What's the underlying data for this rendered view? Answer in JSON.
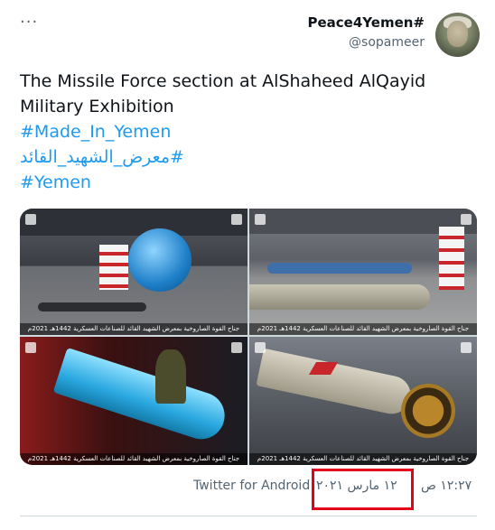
{
  "header": {
    "more_icon": "more-horizontal-icon",
    "display_name": "Peace4Yemen#",
    "handle": "@sopameer"
  },
  "tweet": {
    "line1": "The Missile Force section at AlShaheed AlQayid",
    "line2": "Military Exhibition",
    "hashtags": [
      "#Made_In_Yemen",
      "#معرض_الشهيد_القائد",
      "#Yemen"
    ]
  },
  "media": {
    "captions": [
      "جناح القوة الصاروخية بمعرض الشهيد القائد للصناعات العسكرية 1442هـ 2021م",
      "جناح القوة الصاروخية بمعرض الشهيد القائد للصناعات العسكرية 1442هـ 2021م",
      "جناح القوة الصاروخية بمعرض الشهيد القائد للصناعات العسكرية 1442هـ 2021م",
      "جناح القوة الصاروخية بمعرض الشهيد القائد للصناعات العسكرية 1442هـ 2021م"
    ]
  },
  "meta": {
    "time": "١٢:٢٧ ص",
    "separator": "·",
    "date": "١٢ مارس ٢٠٢١",
    "source": "Twitter for Android"
  },
  "colors": {
    "link": "#1d9bf0",
    "secondary_text": "#536471",
    "highlight_border": "#e3001b"
  }
}
